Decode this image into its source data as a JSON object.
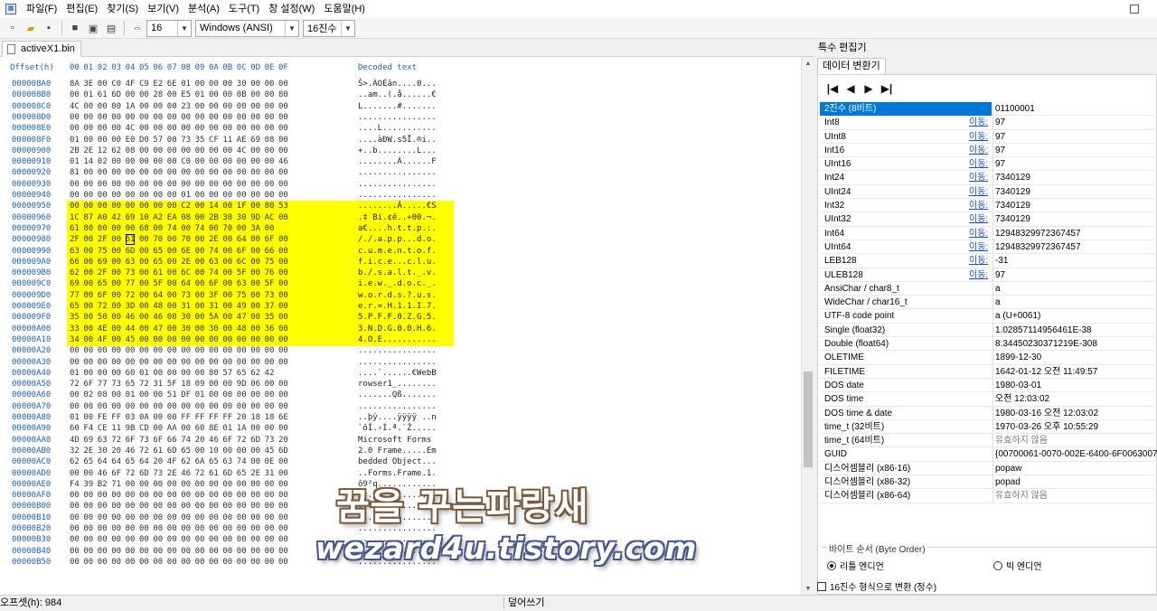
{
  "menu": [
    "파일(F)",
    "편집(E)",
    "찾기(S)",
    "보기(V)",
    "분석(A)",
    "도구(T)",
    "창 설정(W)",
    "도움말(H)"
  ],
  "toolbar": {
    "bytes_per_row": "16",
    "encoding": "Windows (ANSI)",
    "number_base": "16진수"
  },
  "file_tab": "activeX1.bin",
  "hex": {
    "header": {
      "offset": "Offset(h)",
      "columns": [
        "00",
        "01",
        "02",
        "03",
        "04",
        "05",
        "06",
        "07",
        "08",
        "09",
        "0A",
        "0B",
        "0C",
        "0D",
        "0E",
        "0F"
      ],
      "decoded": "Decoded text"
    },
    "highlight_color": "#ffff00",
    "rows": [
      {
        "o": "000008A0",
        "b": [
          "8A",
          "3E",
          "00",
          "C0",
          "4F",
          "C9",
          "E2",
          "6E",
          "01",
          "00",
          "00",
          "00",
          "30",
          "00",
          "00",
          "00"
        ],
        "t": "Š>.ÀOÉân....0..."
      },
      {
        "o": "000008B0",
        "b": [
          "00",
          "01",
          "61",
          "6D",
          "00",
          "00",
          "28",
          "00",
          "E5",
          "01",
          "00",
          "00",
          "0B",
          "00",
          "00",
          "80"
        ],
        "t": "..am..(.å......€"
      },
      {
        "o": "000008C0",
        "b": [
          "4C",
          "00",
          "00",
          "00",
          "1A",
          "00",
          "00",
          "00",
          "23",
          "00",
          "00",
          "00",
          "00",
          "00",
          "00",
          "00"
        ],
        "t": "L.......#......."
      },
      {
        "o": "000008D0",
        "b": [
          "00",
          "00",
          "00",
          "00",
          "00",
          "00",
          "00",
          "00",
          "00",
          "00",
          "00",
          "00",
          "00",
          "00",
          "00",
          "00"
        ],
        "t": "................"
      },
      {
        "o": "000008E0",
        "b": [
          "00",
          "00",
          "00",
          "00",
          "4C",
          "00",
          "00",
          "00",
          "00",
          "00",
          "00",
          "00",
          "00",
          "00",
          "00",
          "00"
        ],
        "t": "....L..........."
      },
      {
        "o": "000008F0",
        "b": [
          "01",
          "00",
          "00",
          "00",
          "E0",
          "D0",
          "57",
          "00",
          "73",
          "35",
          "CF",
          "11",
          "AE",
          "69",
          "08",
          "00"
        ],
        "t": "....àÐW.s5Ï.®i.."
      },
      {
        "o": "00000900",
        "b": [
          "2B",
          "2E",
          "12",
          "62",
          "08",
          "00",
          "00",
          "00",
          "00",
          "00",
          "00",
          "00",
          "4C",
          "00",
          "00",
          "00"
        ],
        "t": "+..b........L..."
      },
      {
        "o": "00000910",
        "b": [
          "01",
          "14",
          "02",
          "00",
          "00",
          "00",
          "00",
          "00",
          "C0",
          "00",
          "00",
          "00",
          "00",
          "00",
          "00",
          "46"
        ],
        "t": "........À......F"
      },
      {
        "o": "00000920",
        "b": [
          "81",
          "00",
          "00",
          "00",
          "00",
          "00",
          "00",
          "00",
          "00",
          "00",
          "00",
          "00",
          "00",
          "00",
          "00",
          "00"
        ],
        "t": "................"
      },
      {
        "o": "00000930",
        "b": [
          "00",
          "00",
          "00",
          "00",
          "00",
          "00",
          "00",
          "00",
          "00",
          "00",
          "00",
          "00",
          "00",
          "00",
          "00",
          "00"
        ],
        "t": "................"
      },
      {
        "o": "00000940",
        "b": [
          "00",
          "00",
          "00",
          "00",
          "00",
          "00",
          "00",
          "00",
          "01",
          "00",
          "00",
          "00",
          "00",
          "00",
          "00",
          "00"
        ],
        "t": "................"
      },
      {
        "o": "00000950",
        "b": [
          "00",
          "00",
          "00",
          "00",
          "00",
          "00",
          "00",
          "00",
          "C2",
          "00",
          "14",
          "00",
          "1F",
          "00",
          "80",
          "53"
        ],
        "t": "........Â.....€S",
        "hl": [
          0,
          15
        ]
      },
      {
        "o": "00000960",
        "b": [
          "1C",
          "87",
          "A0",
          "42",
          "69",
          "10",
          "A2",
          "EA",
          "08",
          "00",
          "2B",
          "30",
          "30",
          "9D",
          "AC",
          "00"
        ],
        "t": ".‡ Bi.¢ê..+00.¬.",
        "hl": [
          0,
          15
        ]
      },
      {
        "o": "00000970",
        "b": [
          "61",
          "80",
          "00",
          "00",
          "00",
          "68",
          "00",
          "74",
          "00",
          "74",
          "00",
          "70",
          "00",
          "3A",
          "00"
        ],
        "t": "a€....h.t.t.p.:.",
        "hl": [
          0,
          15
        ]
      },
      {
        "o": "00000980",
        "b": [
          "2F",
          "00",
          "2F",
          "00",
          "61",
          "00",
          "70",
          "00",
          "70",
          "00",
          "2E",
          "00",
          "64",
          "00",
          "6F",
          "00"
        ],
        "t": "/./.a.p.p...d.o.",
        "hl": [
          0,
          15
        ],
        "cur": 4
      },
      {
        "o": "00000990",
        "b": [
          "63",
          "00",
          "75",
          "00",
          "6D",
          "00",
          "65",
          "00",
          "6E",
          "00",
          "74",
          "00",
          "6F",
          "00",
          "66",
          "00"
        ],
        "t": "c.u.m.e.n.t.o.f.",
        "hl": [
          0,
          15
        ]
      },
      {
        "o": "000009A0",
        "b": [
          "66",
          "00",
          "69",
          "00",
          "63",
          "00",
          "65",
          "00",
          "2E",
          "00",
          "63",
          "00",
          "6C",
          "00",
          "75",
          "00"
        ],
        "t": "f.i.c.e...c.l.u.",
        "hl": [
          0,
          15
        ]
      },
      {
        "o": "000009B0",
        "b": [
          "62",
          "00",
          "2F",
          "00",
          "73",
          "00",
          "61",
          "00",
          "6C",
          "00",
          "74",
          "00",
          "5F",
          "00",
          "76",
          "00"
        ],
        "t": "b./.s.a.l.t._.v.",
        "hl": [
          0,
          15
        ]
      },
      {
        "o": "000009C0",
        "b": [
          "69",
          "00",
          "65",
          "00",
          "77",
          "00",
          "5F",
          "00",
          "64",
          "00",
          "6F",
          "00",
          "63",
          "00",
          "5F",
          "00"
        ],
        "t": "i.e.w._.d.o.c._.",
        "hl": [
          0,
          15
        ]
      },
      {
        "o": "000009D0",
        "b": [
          "77",
          "00",
          "6F",
          "00",
          "72",
          "00",
          "64",
          "00",
          "73",
          "00",
          "3F",
          "00",
          "75",
          "00",
          "73",
          "00"
        ],
        "t": "w.o.r.d.s.?.u.s.",
        "hl": [
          0,
          15
        ]
      },
      {
        "o": "000009E0",
        "b": [
          "65",
          "00",
          "72",
          "00",
          "3D",
          "00",
          "48",
          "00",
          "31",
          "00",
          "31",
          "00",
          "49",
          "00",
          "37",
          "00"
        ],
        "t": "e.r.=.H.1.1.I.7.",
        "hl": [
          0,
          15
        ]
      },
      {
        "o": "000009F0",
        "b": [
          "35",
          "00",
          "50",
          "00",
          "46",
          "00",
          "46",
          "00",
          "30",
          "00",
          "5A",
          "00",
          "47",
          "00",
          "35",
          "00"
        ],
        "t": "5.P.F.F.0.Z.G.5.",
        "hl": [
          0,
          15
        ]
      },
      {
        "o": "00000A00",
        "b": [
          "33",
          "00",
          "4E",
          "00",
          "44",
          "00",
          "47",
          "00",
          "30",
          "00",
          "30",
          "00",
          "48",
          "00",
          "36",
          "00"
        ],
        "t": "3.N.D.G.0.0.H.6.",
        "hl": [
          0,
          15
        ]
      },
      {
        "o": "00000A10",
        "b": [
          "34",
          "00",
          "4F",
          "00",
          "45",
          "00",
          "00",
          "00",
          "00",
          "00",
          "00",
          "00",
          "00",
          "00",
          "00",
          "00"
        ],
        "t": "4.O.E...........",
        "hl": [
          0,
          15
        ]
      },
      {
        "o": "00000A20",
        "b": [
          "00",
          "00",
          "00",
          "00",
          "00",
          "00",
          "00",
          "00",
          "00",
          "00",
          "00",
          "00",
          "00",
          "00",
          "00",
          "00"
        ],
        "t": "................"
      },
      {
        "o": "00000A30",
        "b": [
          "00",
          "00",
          "00",
          "00",
          "00",
          "00",
          "00",
          "00",
          "00",
          "00",
          "00",
          "00",
          "00",
          "00",
          "00",
          "00"
        ],
        "t": "................"
      },
      {
        "o": "00000A40",
        "b": [
          "01",
          "00",
          "00",
          "00",
          "60",
          "01",
          "00",
          "00",
          "00",
          "00",
          "80",
          "57",
          "65",
          "62",
          "42"
        ],
        "t": "....`......€WebB"
      },
      {
        "o": "00000A50",
        "b": [
          "72",
          "6F",
          "77",
          "73",
          "65",
          "72",
          "31",
          "5F",
          "18",
          "09",
          "00",
          "00",
          "9D",
          "06",
          "00",
          "00"
        ],
        "t": "rowser1_........"
      },
      {
        "o": "00000A60",
        "b": [
          "00",
          "02",
          "08",
          "00",
          "01",
          "00",
          "00",
          "51",
          "DF",
          "01",
          "00",
          "00",
          "00",
          "00",
          "00",
          "00"
        ],
        "t": ".......Qß......."
      },
      {
        "o": "00000A70",
        "b": [
          "00",
          "00",
          "00",
          "00",
          "00",
          "00",
          "00",
          "00",
          "00",
          "00",
          "00",
          "00",
          "00",
          "00",
          "00",
          "00"
        ],
        "t": "................"
      },
      {
        "o": "00000A80",
        "b": [
          "01",
          "00",
          "FE",
          "FF",
          "03",
          "0A",
          "00",
          "00",
          "FF",
          "FF",
          "FF",
          "FF",
          "20",
          "18",
          "18",
          "6E"
        ],
        "t": "..þÿ....ÿÿÿÿ ..n"
      },
      {
        "o": "00000A90",
        "b": [
          "60",
          "F4",
          "CE",
          "11",
          "9B",
          "CD",
          "00",
          "AA",
          "00",
          "60",
          "8E",
          "01",
          "1A",
          "00",
          "00",
          "00"
        ],
        "t": "`ôÎ.›Í.ª.`Ž....."
      },
      {
        "o": "00000AA0",
        "b": [
          "4D",
          "69",
          "63",
          "72",
          "6F",
          "73",
          "6F",
          "66",
          "74",
          "20",
          "46",
          "6F",
          "72",
          "6D",
          "73",
          "20"
        ],
        "t": "Microsoft Forms "
      },
      {
        "o": "00000AB0",
        "b": [
          "32",
          "2E",
          "30",
          "20",
          "46",
          "72",
          "61",
          "6D",
          "65",
          "00",
          "10",
          "00",
          "00",
          "00",
          "45",
          "6D"
        ],
        "t": "2.0 Frame.....Em"
      },
      {
        "o": "00000AC0",
        "b": [
          "62",
          "65",
          "64",
          "64",
          "65",
          "64",
          "20",
          "4F",
          "62",
          "6A",
          "65",
          "63",
          "74",
          "00",
          "0E",
          "00"
        ],
        "t": "bedded Object..."
      },
      {
        "o": "00000AD0",
        "b": [
          "00",
          "00",
          "46",
          "6F",
          "72",
          "6D",
          "73",
          "2E",
          "46",
          "72",
          "61",
          "6D",
          "65",
          "2E",
          "31",
          "00"
        ],
        "t": "..Forms.Frame.1."
      },
      {
        "o": "00000AE0",
        "b": [
          "F4",
          "39",
          "B2",
          "71",
          "00",
          "00",
          "00",
          "00",
          "00",
          "00",
          "00",
          "00",
          "00",
          "00",
          "00",
          "00"
        ],
        "t": "ô9²q............"
      },
      {
        "o": "00000AF0",
        "b": [
          "00",
          "00",
          "00",
          "00",
          "00",
          "00",
          "00",
          "00",
          "00",
          "00",
          "00",
          "00",
          "00",
          "00",
          "00",
          "00"
        ],
        "t": "................"
      },
      {
        "o": "00000B00",
        "b": [
          "00",
          "00",
          "00",
          "00",
          "00",
          "00",
          "00",
          "00",
          "00",
          "00",
          "00",
          "00",
          "00",
          "00",
          "00",
          "00"
        ],
        "t": "................"
      },
      {
        "o": "00000B10",
        "b": [
          "00",
          "00",
          "00",
          "00",
          "00",
          "00",
          "00",
          "00",
          "00",
          "00",
          "00",
          "00",
          "00",
          "00",
          "00",
          "00"
        ],
        "t": "................"
      },
      {
        "o": "00000B20",
        "b": [
          "00",
          "00",
          "00",
          "00",
          "00",
          "00",
          "00",
          "00",
          "00",
          "00",
          "00",
          "00",
          "00",
          "00",
          "00",
          "00"
        ],
        "t": "................"
      },
      {
        "o": "00000B30",
        "b": [
          "00",
          "00",
          "00",
          "00",
          "00",
          "00",
          "00",
          "00",
          "00",
          "00",
          "00",
          "00",
          "00",
          "00",
          "00",
          "00"
        ],
        "t": "................"
      },
      {
        "o": "00000B40",
        "b": [
          "00",
          "00",
          "00",
          "00",
          "00",
          "00",
          "00",
          "00",
          "00",
          "00",
          "00",
          "00",
          "00",
          "00",
          "00",
          "00"
        ],
        "t": "................"
      },
      {
        "o": "00000B50",
        "b": [
          "00",
          "00",
          "00",
          "00",
          "00",
          "00",
          "00",
          "00",
          "00",
          "00",
          "00",
          "00",
          "00",
          "00",
          "00",
          "00"
        ],
        "t": "................"
      }
    ]
  },
  "inspector": {
    "title": "특수 편집기",
    "tab": "데이터 변환기",
    "move_label": "이동:",
    "rows": [
      {
        "k": "2진수 (8비트)",
        "v": "01100001",
        "sel": true
      },
      {
        "k": "Int8",
        "v": "97",
        "mv": true
      },
      {
        "k": "UInt8",
        "v": "97",
        "mv": true
      },
      {
        "k": "Int16",
        "v": "97",
        "mv": true
      },
      {
        "k": "UInt16",
        "v": "97",
        "mv": true
      },
      {
        "k": "Int24",
        "v": "7340129",
        "mv": true
      },
      {
        "k": "UInt24",
        "v": "7340129",
        "mv": true
      },
      {
        "k": "Int32",
        "v": "7340129",
        "mv": true
      },
      {
        "k": "UInt32",
        "v": "7340129",
        "mv": true
      },
      {
        "k": "Int64",
        "v": "12948329972367457",
        "mv": true
      },
      {
        "k": "UInt64",
        "v": "12948329972367457",
        "mv": true
      },
      {
        "k": "LEB128",
        "v": "-31",
        "mv": true
      },
      {
        "k": "ULEB128",
        "v": "97",
        "mv": true
      },
      {
        "k": "AnsiChar / char8_t",
        "v": "a"
      },
      {
        "k": "WideChar / char16_t",
        "v": "a"
      },
      {
        "k": "UTF-8 code point",
        "v": "a (U+0061)"
      },
      {
        "k": "Single (float32)",
        "v": "1.02857114956461E-38"
      },
      {
        "k": "Double (float64)",
        "v": "8.34450230371219E-308"
      },
      {
        "k": "OLETIME",
        "v": "1899-12-30"
      },
      {
        "k": "FILETIME",
        "v": "1642-01-12 오전 11:49:57"
      },
      {
        "k": "DOS date",
        "v": "1980-03-01"
      },
      {
        "k": "DOS time",
        "v": "오전 12:03:02"
      },
      {
        "k": "DOS time & date",
        "v": "1980-03-16 오전 12:03:02"
      },
      {
        "k": "time_t (32비트)",
        "v": "1970-03-26 오후 10:55:29"
      },
      {
        "k": "time_t (64비트)",
        "v": "유효하지 않음",
        "gray": true
      },
      {
        "k": "GUID",
        "v": "{00700061-0070-002E-6400-6F0063007"
      },
      {
        "k": "디스어셈블리 (x86-16)",
        "v": "popaw"
      },
      {
        "k": "디스어셈블리 (x86-32)",
        "v": "popad"
      },
      {
        "k": "디스어셈블리 (x86-64)",
        "v": "유효하지 않음",
        "gray": true
      }
    ],
    "byte_order": {
      "label": "바이트 순서 (Byte Order)",
      "little": "리틀 엔디언",
      "big": "빅 엔디언",
      "selected": "little"
    },
    "hex_checkbox": "16진수 형식으로 변환 (정수)"
  },
  "status": {
    "offset": "오프셋(h): 984",
    "mode": "덮어쓰기"
  },
  "watermark": {
    "line1": "꿈을 꾸는파랑새",
    "line2": "wezard4u.tistory.com"
  }
}
